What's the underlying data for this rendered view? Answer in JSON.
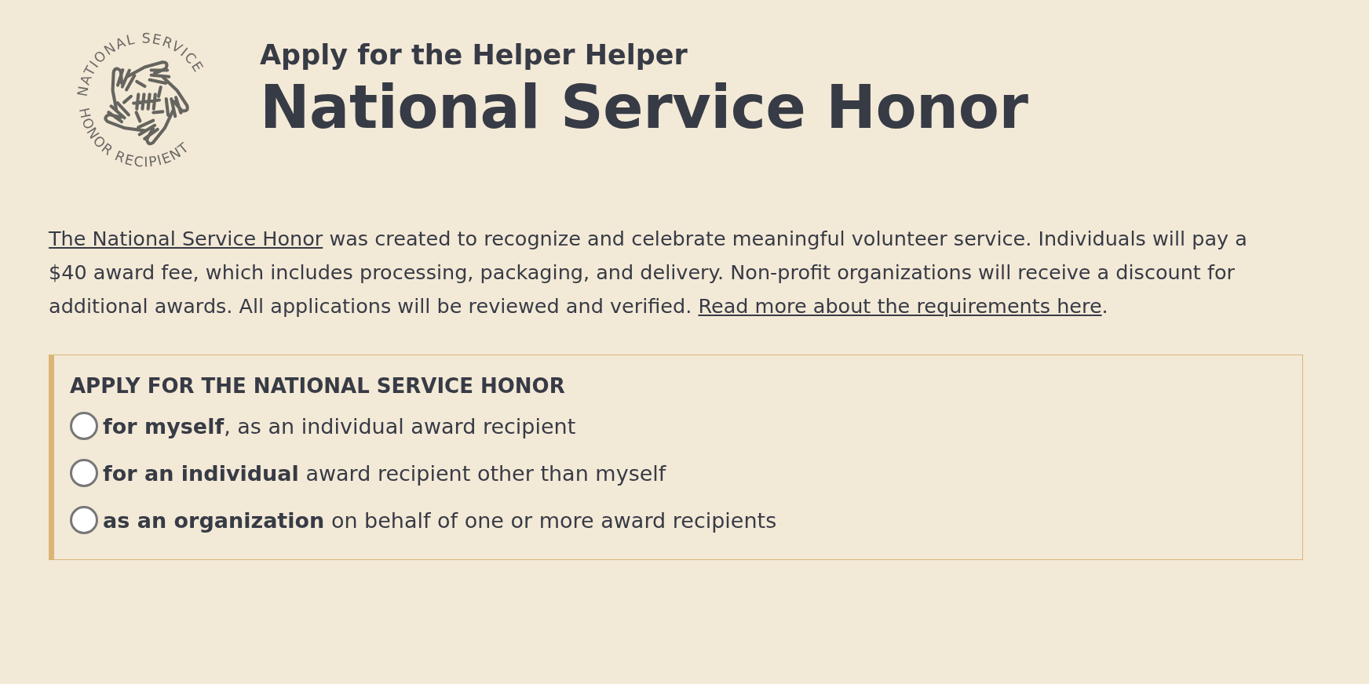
{
  "logo": {
    "top_text": "NATIONAL SERVICE",
    "bottom_text": "HONOR RECIPIENT"
  },
  "header": {
    "subtitle": "Apply for the Helper Helper",
    "title": "National Service Honor"
  },
  "intro": {
    "link": "The National Service Honor",
    "text": " was created to recognize and celebrate meaningful volunteer service. Individuals will pay a $40 award fee, which includes processing, packaging, and delivery. Non-profit organizations will receive a discount for additional awards. All applications will be reviewed and verified. ",
    "more_link": "Read more about the requirements here",
    "end": "."
  },
  "form": {
    "title": "APPLY FOR THE NATIONAL SERVICE HONOR",
    "options": [
      {
        "text": "**for myself**, as an individual award recipient",
        "selected": false
      },
      {
        "text": "**for an individual** award recipient other than myself",
        "selected": false
      },
      {
        "text": "**as an organization** on behalf of one or more award recipients",
        "selected": false
      }
    ]
  }
}
